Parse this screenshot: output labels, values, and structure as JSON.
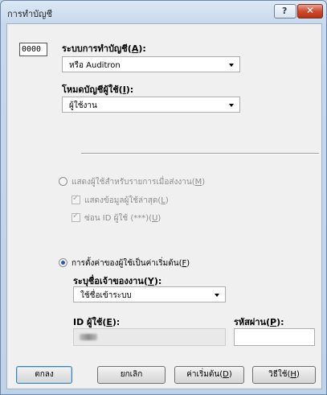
{
  "window": {
    "title": "การทำบัญชี"
  },
  "titlebar": {
    "help_glyph": "?",
    "close_glyph": "✕"
  },
  "counter_display": "0000",
  "accounting": {
    "label_text": "ระบบการทำบัญชี(",
    "label_key": "A",
    "label_end": "):",
    "value": "หรือ Auditron"
  },
  "user_mode": {
    "label_text": "โหมดบัญชีผู้ใช้(",
    "label_key": "I",
    "label_end": "):",
    "value": "ผู้ใช้งาน"
  },
  "show_prompt": {
    "label_text": "แสดงผู้ใช้สำหรับรายการเมื่อส่งงาน(",
    "label_key": "M",
    "label_end": ")",
    "selected": false
  },
  "last_user": {
    "label_text": "แสดงข้อมูลผู้ใช้ล่าสุด(",
    "label_key": "L",
    "label_end": ")",
    "checked": true
  },
  "hide_id": {
    "label_text": "ซ่อน  ID ผู้ใช้ (***)(",
    "label_key": "U",
    "label_end": ")",
    "checked": true
  },
  "defaults": {
    "label_text": "การตั้งค่าของผู้ใช้เป็นค่าเริ่มต้น(",
    "label_key": "F",
    "label_end": ")",
    "selected": true
  },
  "owner": {
    "label_text": "ระบุชื่อเจ้าของงาน(",
    "label_key": "Y",
    "label_end": "):",
    "value": "ใช้ชื่อเข้าระบบ"
  },
  "user_id": {
    "label_text": "ID ผู้ใช้(",
    "label_key": "E",
    "label_end": "):"
  },
  "passcode": {
    "label_text": "รหัสผ่าน(",
    "label_key": "P",
    "label_end": "):"
  },
  "buttons": {
    "ok": "ตกลง",
    "cancel": "ยกเลิก",
    "default_text": "ค่าเริ่มต้น(",
    "default_key": "D",
    "default_end": ")",
    "help_text": "วิธีใช้(",
    "help_key": "H",
    "help_end": ")"
  }
}
